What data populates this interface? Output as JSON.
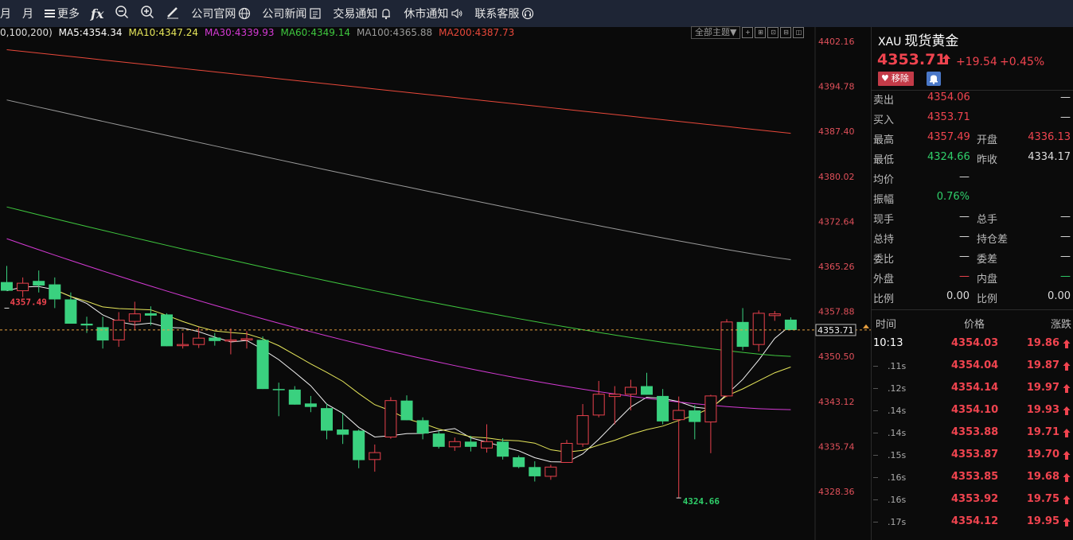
{
  "toolbar": {
    "items": [
      {
        "label": "月"
      },
      {
        "label": "月"
      },
      {
        "label": "更多"
      },
      {
        "label": "公司官网"
      },
      {
        "label": "公司新闻"
      },
      {
        "label": "交易通知"
      },
      {
        "label": "休市通知"
      },
      {
        "label": "联系客服"
      }
    ]
  },
  "ma_legend": {
    "prefix": "0,100,200)",
    "items": [
      {
        "text": "MA5:4354.34",
        "color": "#ffffff"
      },
      {
        "text": "MA10:4347.24",
        "color": "#e6e65a"
      },
      {
        "text": "MA30:4339.93",
        "color": "#d43ad4"
      },
      {
        "text": "MA60:4349.14",
        "color": "#3fc83f"
      },
      {
        "text": "MA100:4365.88",
        "color": "#9a9a9a"
      },
      {
        "text": "MA200:4387.73",
        "color": "#e8483a"
      }
    ]
  },
  "theme_select": "全部主题▼",
  "chart_data": {
    "type": "candlestick",
    "y_ticks": [
      "4402.16",
      "4394.78",
      "4387.40",
      "4380.02",
      "4372.64",
      "4365.26",
      "4357.88",
      "4350.50",
      "4343.12",
      "4335.74",
      "4328.36"
    ],
    "ylim": [
      4325.5,
      4403.5
    ],
    "current_price": 4353.71,
    "current_label": "4353.71",
    "high_label": "4357.49",
    "low_label": "4324.66",
    "high_value": 4357.49,
    "low_value": 4324.66,
    "candles": [
      {
        "o": 4362.0,
        "h": 4364.8,
        "l": 4360.5,
        "c": 4360.5
      },
      {
        "o": 4360.5,
        "h": 4362.8,
        "l": 4359.4,
        "c": 4361.8
      },
      {
        "o": 4362.2,
        "h": 4364.0,
        "l": 4360.2,
        "c": 4361.4
      },
      {
        "o": 4361.6,
        "h": 4362.8,
        "l": 4357.5,
        "c": 4359.0
      },
      {
        "o": 4359.0,
        "h": 4360.2,
        "l": 4354.8,
        "c": 4354.8
      },
      {
        "o": 4354.8,
        "h": 4356.0,
        "l": 4353.2,
        "c": 4354.5
      },
      {
        "o": 4354.2,
        "h": 4356.0,
        "l": 4350.5,
        "c": 4351.9
      },
      {
        "o": 4352.0,
        "h": 4356.8,
        "l": 4350.8,
        "c": 4355.4
      },
      {
        "o": 4355.2,
        "h": 4358.6,
        "l": 4353.8,
        "c": 4356.5
      },
      {
        "o": 4356.6,
        "h": 4357.8,
        "l": 4354.5,
        "c": 4356.2
      },
      {
        "o": 4356.4,
        "h": 4356.6,
        "l": 4350.9,
        "c": 4350.9
      },
      {
        "o": 4351.0,
        "h": 4353.2,
        "l": 4350.5,
        "c": 4351.2
      },
      {
        "o": 4351.2,
        "h": 4354.2,
        "l": 4350.6,
        "c": 4352.3
      },
      {
        "o": 4352.4,
        "h": 4353.2,
        "l": 4351.0,
        "c": 4351.8
      },
      {
        "o": 4351.8,
        "h": 4354.0,
        "l": 4349.5,
        "c": 4352.0
      },
      {
        "o": 4352.0,
        "h": 4353.5,
        "l": 4350.5,
        "c": 4352.2
      },
      {
        "o": 4352.0,
        "h": 4352.6,
        "l": 4343.5,
        "c": 4343.5
      },
      {
        "o": 4343.5,
        "h": 4344.6,
        "l": 4338.8,
        "c": 4343.4
      },
      {
        "o": 4343.4,
        "h": 4344.0,
        "l": 4340.8,
        "c": 4340.8
      },
      {
        "o": 4341.0,
        "h": 4342.3,
        "l": 4339.5,
        "c": 4340.4
      },
      {
        "o": 4340.2,
        "h": 4341.0,
        "l": 4334.8,
        "c": 4336.3
      },
      {
        "o": 4336.5,
        "h": 4339.2,
        "l": 4334.0,
        "c": 4335.6
      },
      {
        "o": 4336.3,
        "h": 4336.5,
        "l": 4329.8,
        "c": 4331.2
      },
      {
        "o": 4331.3,
        "h": 4333.9,
        "l": 4329.2,
        "c": 4332.5
      },
      {
        "o": 4335.2,
        "h": 4342.1,
        "l": 4334.9,
        "c": 4341.5
      },
      {
        "o": 4341.5,
        "h": 4342.4,
        "l": 4338.1,
        "c": 4338.1
      },
      {
        "o": 4338.1,
        "h": 4338.6,
        "l": 4334.8,
        "c": 4335.8
      },
      {
        "o": 4335.8,
        "h": 4336.2,
        "l": 4333.2,
        "c": 4333.5
      },
      {
        "o": 4333.5,
        "h": 4335.1,
        "l": 4332.8,
        "c": 4334.4
      },
      {
        "o": 4334.4,
        "h": 4335.4,
        "l": 4332.7,
        "c": 4333.5
      },
      {
        "o": 4333.3,
        "h": 4337.4,
        "l": 4332.5,
        "c": 4334.4
      },
      {
        "o": 4334.4,
        "h": 4335.0,
        "l": 4331.3,
        "c": 4331.8
      },
      {
        "o": 4331.7,
        "h": 4332.0,
        "l": 4329.8,
        "c": 4330.0
      },
      {
        "o": 4330.0,
        "h": 4331.0,
        "l": 4327.5,
        "c": 4328.4
      },
      {
        "o": 4328.4,
        "h": 4330.4,
        "l": 4327.8,
        "c": 4330.0
      },
      {
        "o": 4330.8,
        "h": 4334.7,
        "l": 4330.8,
        "c": 4334.1
      },
      {
        "o": 4334.0,
        "h": 4340.9,
        "l": 4333.5,
        "c": 4338.9
      },
      {
        "o": 4339.0,
        "h": 4344.9,
        "l": 4338.6,
        "c": 4342.6
      },
      {
        "o": 4342.2,
        "h": 4344.0,
        "l": 4337.4,
        "c": 4342.6
      },
      {
        "o": 4342.6,
        "h": 4345.1,
        "l": 4339.8,
        "c": 4343.8
      },
      {
        "o": 4344.0,
        "h": 4346.3,
        "l": 4342.5,
        "c": 4342.5
      },
      {
        "o": 4342.3,
        "h": 4343.5,
        "l": 4337.4,
        "c": 4337.9
      },
      {
        "o": 4338.2,
        "h": 4342.2,
        "l": 4324.7,
        "c": 4339.8
      },
      {
        "o": 4339.8,
        "h": 4340.7,
        "l": 4334.8,
        "c": 4337.8
      },
      {
        "o": 4337.8,
        "h": 4342.5,
        "l": 4332.4,
        "c": 4342.3
      },
      {
        "o": 4342.3,
        "h": 4355.6,
        "l": 4342.1,
        "c": 4355.1
      },
      {
        "o": 4355.1,
        "h": 4357.5,
        "l": 4350.2,
        "c": 4350.8
      },
      {
        "o": 4351.2,
        "h": 4357.1,
        "l": 4350.0,
        "c": 4356.6
      },
      {
        "o": 4356.2,
        "h": 4357.0,
        "l": 4355.3,
        "c": 4356.5
      },
      {
        "o": 4355.5,
        "h": 4355.9,
        "l": 4353.7,
        "c": 4353.7
      }
    ]
  },
  "panel": {
    "code": "XAU",
    "name": "现货黄金",
    "price": "4353.71",
    "change": "+19.54",
    "change_pct": "+0.45%",
    "remove_label": "移除",
    "quote_rows": [
      {
        "l1": "卖出",
        "v1": "4354.06",
        "v1c": "red",
        "l2": "",
        "v2": "—",
        "v2c": "white"
      },
      {
        "l1": "买入",
        "v1": "4353.71",
        "v1c": "red",
        "l2": "",
        "v2": "—",
        "v2c": "white"
      },
      {
        "l1": "最高",
        "v1": "4357.49",
        "v1c": "red",
        "l2": "开盘",
        "v2": "4336.13",
        "v2c": "red"
      },
      {
        "l1": "最低",
        "v1": "4324.66",
        "v1c": "green",
        "l2": "昨收",
        "v2": "4334.17",
        "v2c": "white"
      },
      {
        "l1": "均价",
        "v1": "—",
        "v1c": "white",
        "l2": "",
        "v2": "",
        "v2c": "white"
      },
      {
        "l1": "振幅",
        "v1": "0.76%",
        "v1c": "green",
        "l2": "",
        "v2": "",
        "v2c": "white"
      },
      {
        "l1": "现手",
        "v1": "—",
        "v1c": "white",
        "l2": "总手",
        "v2": "—",
        "v2c": "white"
      },
      {
        "l1": "总持",
        "v1": "—",
        "v1c": "white",
        "l2": "持仓差",
        "v2": "—",
        "v2c": "white"
      },
      {
        "l1": "委比",
        "v1": "—",
        "v1c": "white",
        "l2": "委差",
        "v2": "—",
        "v2c": "white"
      },
      {
        "l1": "外盘",
        "v1": "—",
        "v1c": "red",
        "l2": "内盘",
        "v2": "—",
        "v2c": "green"
      },
      {
        "l1": "比例",
        "v1": "0.00",
        "v1c": "white",
        "l2": "比例",
        "v2": "0.00",
        "v2c": "white"
      }
    ],
    "tick_head": {
      "time": "时间",
      "price": "价格",
      "change": "涨跌"
    },
    "ticks": [
      {
        "time": "10:13",
        "price": "4354.03",
        "change": "19.86"
      },
      {
        "time": ".11s",
        "price": "4354.04",
        "change": "19.87"
      },
      {
        "time": ".12s",
        "price": "4354.14",
        "change": "19.97"
      },
      {
        "time": ".14s",
        "price": "4354.10",
        "change": "19.93"
      },
      {
        "time": ".14s",
        "price": "4353.88",
        "change": "19.71"
      },
      {
        "time": ".15s",
        "price": "4353.87",
        "change": "19.70"
      },
      {
        "time": ".16s",
        "price": "4353.85",
        "change": "19.68"
      },
      {
        "time": ".16s",
        "price": "4353.92",
        "change": "19.75"
      },
      {
        "time": ".17s",
        "price": "4354.12",
        "change": "19.95"
      }
    ]
  }
}
